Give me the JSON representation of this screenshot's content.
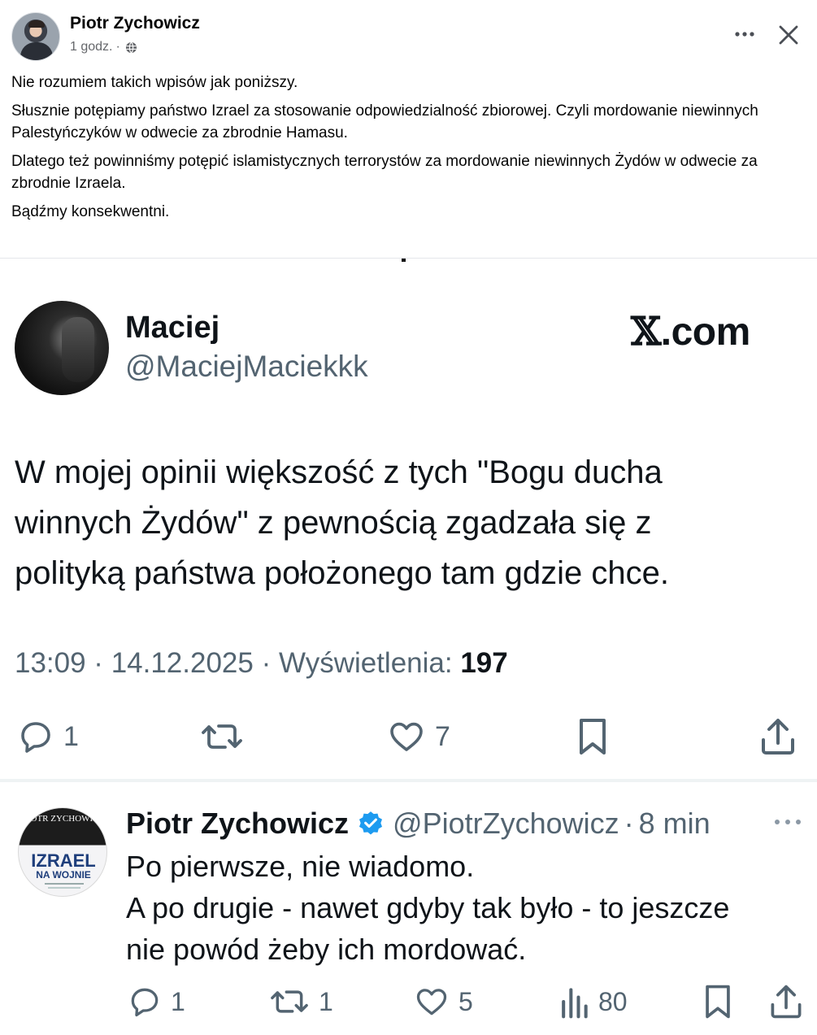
{
  "post": {
    "author": "Piotr Zychowicz",
    "time": "1 godz.",
    "separator": "·",
    "paragraphs": [
      "Nie rozumiem takich wpisów jak poniższy.",
      "Słusznie potępiamy państwo Izrael za stosowanie odpowiedzialność zbiorowej. Czyli mordowanie niewinnych Palestyńczyków w odwecie za zbrodnie Hamasu.",
      "Dlatego też powinniśmy potępić islamistycznych terrorystów za mordowanie niewinnych Żydów w odwecie za zbrodnie Izraela.",
      "Bądźmy konsekwentni."
    ],
    "icons": {
      "more": "more-horizontal-icon",
      "close": "close-icon",
      "privacy": "globe-icon"
    }
  },
  "tweet": {
    "name": "Maciej",
    "handle": "@MaciejMaciekkk",
    "brand": ".com",
    "brand_glyph": "𝕏",
    "text_lines": [
      "W mojej opinii większość z tych \"Bogu ducha",
      "winnych Żydów\" z pewnością zgadzała się z",
      "polityką państwa położonego tam gdzie chce."
    ],
    "timestamp": "13:09 · 14.12.2025 · Wyświetlenia:",
    "views": "197",
    "actions": {
      "replies": "1",
      "retweets": "",
      "likes": "7"
    }
  },
  "reply": {
    "avatar_top": "PIOTR ZYCHOWICZ",
    "avatar_title": "IZRAEL",
    "avatar_subtitle": "NA WOJNIE",
    "name": "Piotr Zychowicz",
    "handle": "@PiotrZychowicz",
    "dot": "·",
    "time": "8 min",
    "text_lines": [
      "Po pierwsze, nie wiadomo.",
      "A po drugie - nawet gdyby tak było - to jeszcze",
      "nie powód żeby ich mordować."
    ],
    "actions": {
      "replies": "1",
      "retweets": "1",
      "likes": "5",
      "views": "80"
    }
  },
  "colors": {
    "text": "#050505",
    "muted": "#65676b",
    "x_text": "#0f1419",
    "x_muted": "#536471",
    "verified": "#1d9bf0"
  }
}
